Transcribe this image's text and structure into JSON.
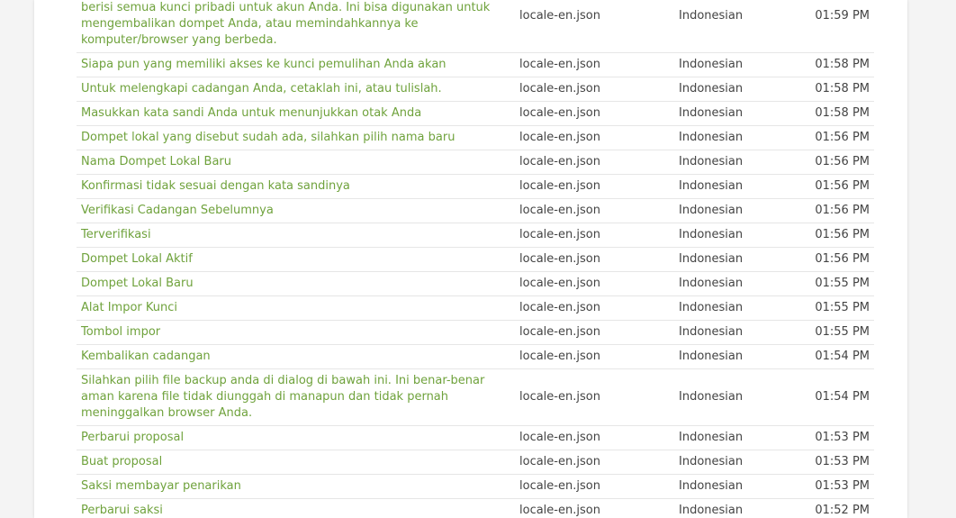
{
  "rows": [
    {
      "text": "kata kunci ini. File ini dienkripsi dengan kata kunci dompet Anda, dan berisi semua kunci pribadi untuk akun Anda. Ini bisa digunakan untuk mengembalikan dompet Anda, atau memindahkannya ke komputer/browser yang berbeda.",
      "file": "locale-en.json",
      "language": "Indonesian",
      "time": "01:59 PM"
    },
    {
      "text": "Siapa pun yang memiliki akses ke kunci pemulihan Anda akan",
      "file": "locale-en.json",
      "language": "Indonesian",
      "time": "01:58 PM"
    },
    {
      "text": "Untuk melengkapi cadangan Anda, cetaklah ini, atau tulislah.",
      "file": "locale-en.json",
      "language": "Indonesian",
      "time": "01:58 PM"
    },
    {
      "text": "Masukkan kata sandi Anda untuk menunjukkan otak Anda",
      "file": "locale-en.json",
      "language": "Indonesian",
      "time": "01:58 PM"
    },
    {
      "text": "Dompet lokal yang disebut sudah ada, silahkan pilih nama baru",
      "file": "locale-en.json",
      "language": "Indonesian",
      "time": "01:56 PM"
    },
    {
      "text": "Nama Dompet Lokal Baru",
      "file": "locale-en.json",
      "language": "Indonesian",
      "time": "01:56 PM"
    },
    {
      "text": "Konfirmasi tidak sesuai dengan kata sandinya",
      "file": "locale-en.json",
      "language": "Indonesian",
      "time": "01:56 PM"
    },
    {
      "text": "Verifikasi Cadangan Sebelumnya",
      "file": "locale-en.json",
      "language": "Indonesian",
      "time": "01:56 PM"
    },
    {
      "text": "Terverifikasi",
      "file": "locale-en.json",
      "language": "Indonesian",
      "time": "01:56 PM"
    },
    {
      "text": "Dompet Lokal Aktif",
      "file": "locale-en.json",
      "language": "Indonesian",
      "time": "01:56 PM"
    },
    {
      "text": "Dompet Lokal Baru",
      "file": "locale-en.json",
      "language": "Indonesian",
      "time": "01:55 PM"
    },
    {
      "text": "Alat Impor Kunci",
      "file": "locale-en.json",
      "language": "Indonesian",
      "time": "01:55 PM"
    },
    {
      "text": "Tombol impor",
      "file": "locale-en.json",
      "language": "Indonesian",
      "time": "01:55 PM"
    },
    {
      "text": "Kembalikan cadangan",
      "file": "locale-en.json",
      "language": "Indonesian",
      "time": "01:54 PM"
    },
    {
      "text": "Silahkan pilih file backup anda di dialog di bawah ini. Ini benar-benar aman karena file tidak diunggah di manapun dan tidak pernah meninggalkan browser Anda.",
      "file": "locale-en.json",
      "language": "Indonesian",
      "time": "01:54 PM"
    },
    {
      "text": "Perbarui proposal",
      "file": "locale-en.json",
      "language": "Indonesian",
      "time": "01:53 PM"
    },
    {
      "text": "Buat proposal",
      "file": "locale-en.json",
      "language": "Indonesian",
      "time": "01:53 PM"
    },
    {
      "text": "Saksi membayar penarikan",
      "file": "locale-en.json",
      "language": "Indonesian",
      "time": "01:53 PM"
    },
    {
      "text": "Perbarui saksi",
      "file": "locale-en.json",
      "language": "Indonesian",
      "time": "01:52 PM"
    }
  ]
}
